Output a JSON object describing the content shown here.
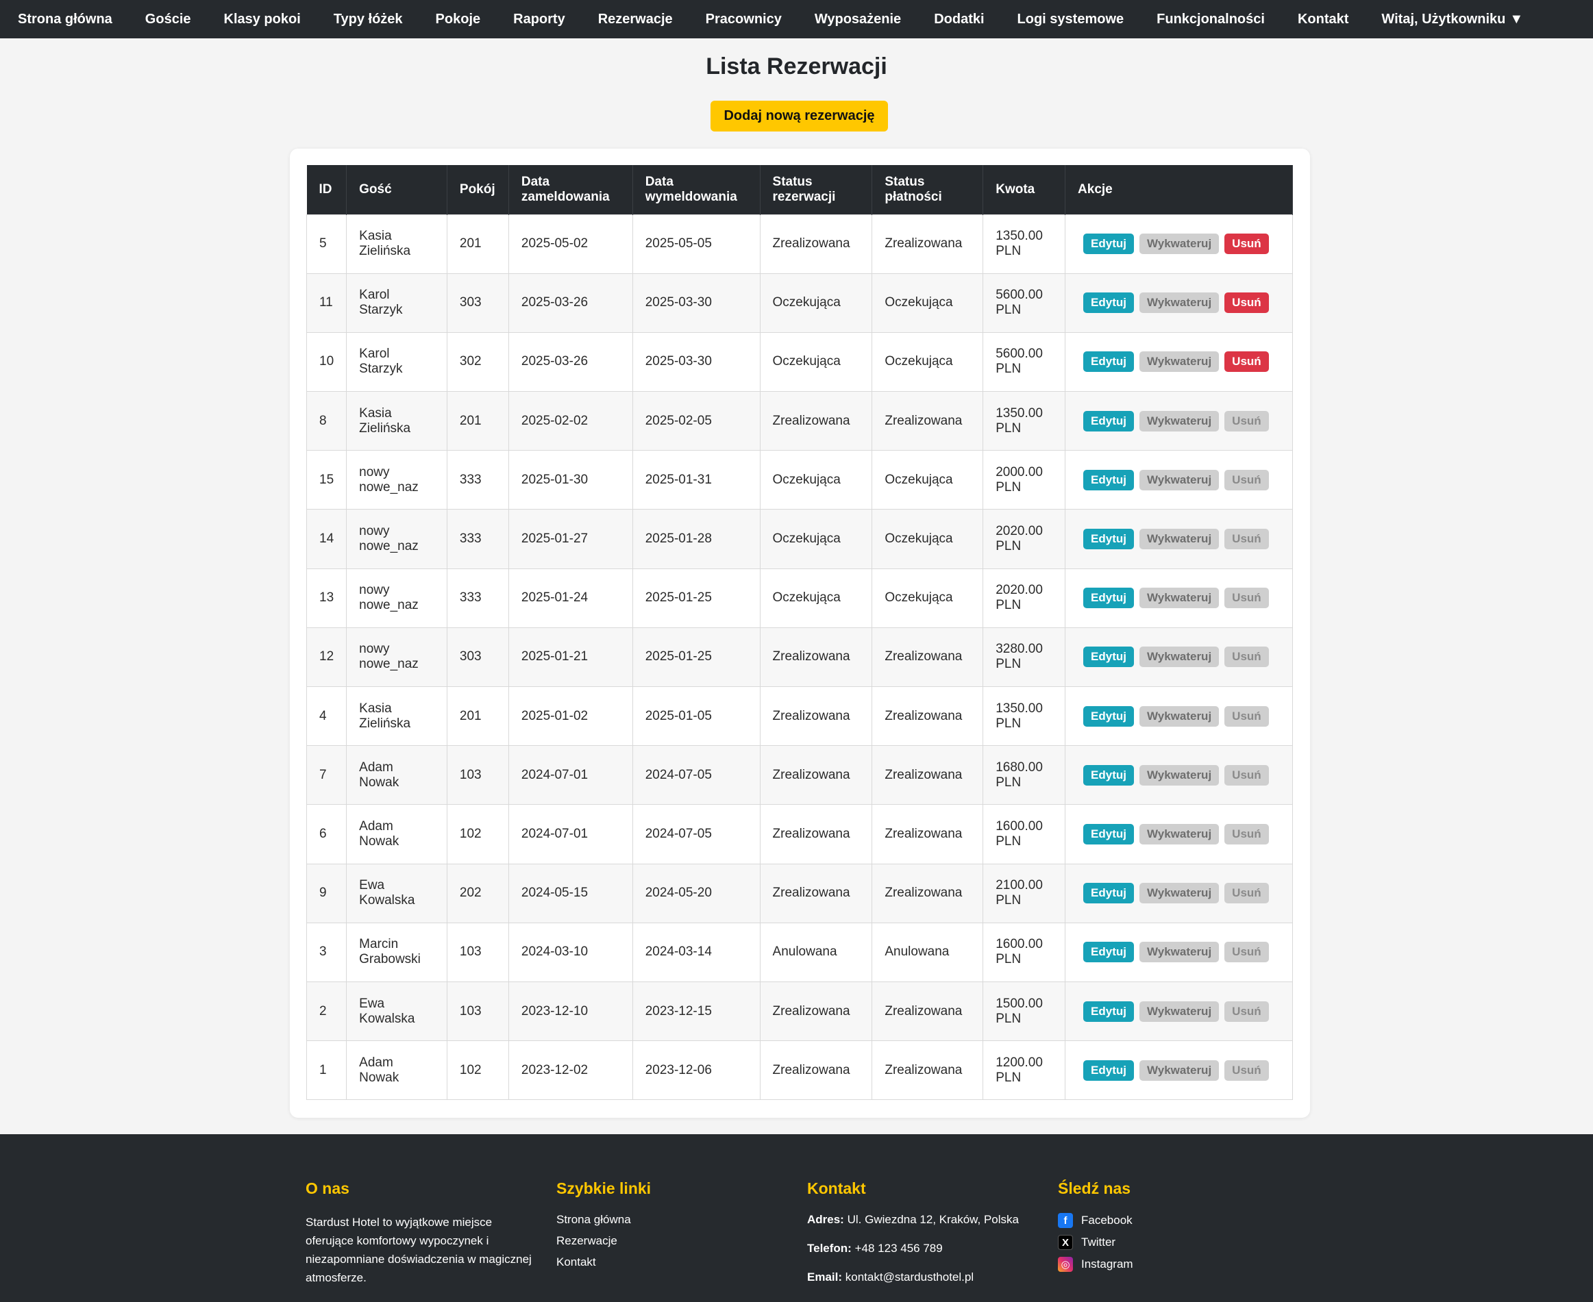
{
  "nav": {
    "items": [
      "Strona główna",
      "Goście",
      "Klasy pokoi",
      "Typy łóżek",
      "Pokoje",
      "Raporty",
      "Rezerwacje",
      "Pracownicy",
      "Wyposażenie",
      "Dodatki",
      "Logi systemowe",
      "Funkcjonalności",
      "Kontakt"
    ],
    "user_label": "Witaj, Użytkowniku",
    "user_caret": "▼"
  },
  "page": {
    "title": "Lista Rezerwacji",
    "add_button": "Dodaj nową rezerwację"
  },
  "table": {
    "headers": [
      "ID",
      "Gość",
      "Pokój",
      "Data zameldowania",
      "Data wymeldowania",
      "Status rezerwacji",
      "Status płatności",
      "Kwota",
      "Akcje"
    ],
    "actions": {
      "edit": "Edytuj",
      "checkout": "Wykwateruj",
      "delete": "Usuń"
    },
    "rows": [
      {
        "id": "5",
        "guest": "Kasia Zielińska",
        "room": "201",
        "checkin": "2025-05-02",
        "checkout": "2025-05-05",
        "res_status": "Zrealizowana",
        "pay_status": "Zrealizowana",
        "amount": "1350.00 PLN",
        "delete_active": true
      },
      {
        "id": "11",
        "guest": "Karol Starzyk",
        "room": "303",
        "checkin": "2025-03-26",
        "checkout": "2025-03-30",
        "res_status": "Oczekująca",
        "pay_status": "Oczekująca",
        "amount": "5600.00 PLN",
        "delete_active": true
      },
      {
        "id": "10",
        "guest": "Karol Starzyk",
        "room": "302",
        "checkin": "2025-03-26",
        "checkout": "2025-03-30",
        "res_status": "Oczekująca",
        "pay_status": "Oczekująca",
        "amount": "5600.00 PLN",
        "delete_active": true
      },
      {
        "id": "8",
        "guest": "Kasia Zielińska",
        "room": "201",
        "checkin": "2025-02-02",
        "checkout": "2025-02-05",
        "res_status": "Zrealizowana",
        "pay_status": "Zrealizowana",
        "amount": "1350.00 PLN",
        "delete_active": false
      },
      {
        "id": "15",
        "guest": "nowy nowe_naz",
        "room": "333",
        "checkin": "2025-01-30",
        "checkout": "2025-01-31",
        "res_status": "Oczekująca",
        "pay_status": "Oczekująca",
        "amount": "2000.00 PLN",
        "delete_active": false
      },
      {
        "id": "14",
        "guest": "nowy nowe_naz",
        "room": "333",
        "checkin": "2025-01-27",
        "checkout": "2025-01-28",
        "res_status": "Oczekująca",
        "pay_status": "Oczekująca",
        "amount": "2020.00 PLN",
        "delete_active": false
      },
      {
        "id": "13",
        "guest": "nowy nowe_naz",
        "room": "333",
        "checkin": "2025-01-24",
        "checkout": "2025-01-25",
        "res_status": "Oczekująca",
        "pay_status": "Oczekująca",
        "amount": "2020.00 PLN",
        "delete_active": false
      },
      {
        "id": "12",
        "guest": "nowy nowe_naz",
        "room": "303",
        "checkin": "2025-01-21",
        "checkout": "2025-01-25",
        "res_status": "Zrealizowana",
        "pay_status": "Zrealizowana",
        "amount": "3280.00 PLN",
        "delete_active": false
      },
      {
        "id": "4",
        "guest": "Kasia Zielińska",
        "room": "201",
        "checkin": "2025-01-02",
        "checkout": "2025-01-05",
        "res_status": "Zrealizowana",
        "pay_status": "Zrealizowana",
        "amount": "1350.00 PLN",
        "delete_active": false
      },
      {
        "id": "7",
        "guest": "Adam Nowak",
        "room": "103",
        "checkin": "2024-07-01",
        "checkout": "2024-07-05",
        "res_status": "Zrealizowana",
        "pay_status": "Zrealizowana",
        "amount": "1680.00 PLN",
        "delete_active": false
      },
      {
        "id": "6",
        "guest": "Adam Nowak",
        "room": "102",
        "checkin": "2024-07-01",
        "checkout": "2024-07-05",
        "res_status": "Zrealizowana",
        "pay_status": "Zrealizowana",
        "amount": "1600.00 PLN",
        "delete_active": false
      },
      {
        "id": "9",
        "guest": "Ewa Kowalska",
        "room": "202",
        "checkin": "2024-05-15",
        "checkout": "2024-05-20",
        "res_status": "Zrealizowana",
        "pay_status": "Zrealizowana",
        "amount": "2100.00 PLN",
        "delete_active": false
      },
      {
        "id": "3",
        "guest": "Marcin Grabowski",
        "room": "103",
        "checkin": "2024-03-10",
        "checkout": "2024-03-14",
        "res_status": "Anulowana",
        "pay_status": "Anulowana",
        "amount": "1600.00 PLN",
        "delete_active": false
      },
      {
        "id": "2",
        "guest": "Ewa Kowalska",
        "room": "103",
        "checkin": "2023-12-10",
        "checkout": "2023-12-15",
        "res_status": "Zrealizowana",
        "pay_status": "Zrealizowana",
        "amount": "1500.00 PLN",
        "delete_active": false
      },
      {
        "id": "1",
        "guest": "Adam Nowak",
        "room": "102",
        "checkin": "2023-12-02",
        "checkout": "2023-12-06",
        "res_status": "Zrealizowana",
        "pay_status": "Zrealizowana",
        "amount": "1200.00 PLN",
        "delete_active": false
      }
    ]
  },
  "footer": {
    "about": {
      "title": "O nas",
      "text": "Stardust Hotel to wyjątkowe miejsce oferujące komfortowy wypoczynek i niezapomniane doświadczenia w magicznej atmosferze."
    },
    "quick_links": {
      "title": "Szybkie linki",
      "links": [
        "Strona główna",
        "Rezerwacje",
        "Kontakt"
      ]
    },
    "contact": {
      "title": "Kontakt",
      "address_label": "Adres:",
      "address": "Ul. Gwiezdna 12, Kraków, Polska",
      "phone_label": "Telefon:",
      "phone": "+48 123 456 789",
      "email_label": "Email:",
      "email": "kontakt@stardusthotel.pl"
    },
    "social": {
      "title": "Śledź nas",
      "items": [
        {
          "label": "Facebook",
          "icon": "facebook-icon"
        },
        {
          "label": "Twitter",
          "icon": "x-twitter-icon"
        },
        {
          "label": "Instagram",
          "icon": "instagram-icon"
        }
      ]
    }
  },
  "colors": {
    "nav_bg": "#262a2e",
    "accent": "#ffc700",
    "edit": "#17a2b8",
    "delete": "#dc3545",
    "disabled": "#cfcfcf"
  }
}
